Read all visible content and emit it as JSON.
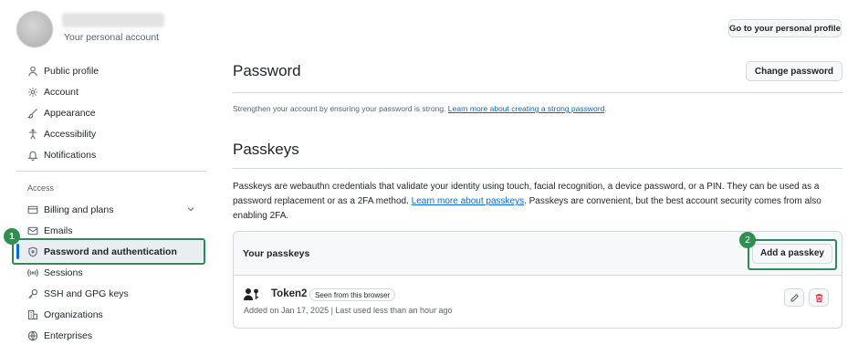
{
  "header": {
    "account_label": "Your personal account",
    "profile_button": "Go to your personal profile"
  },
  "sidebar": {
    "items": [
      {
        "label": "Public profile",
        "icon": "person-icon"
      },
      {
        "label": "Account",
        "icon": "gear-icon"
      },
      {
        "label": "Appearance",
        "icon": "paintbrush-icon"
      },
      {
        "label": "Accessibility",
        "icon": "accessibility-icon"
      },
      {
        "label": "Notifications",
        "icon": "bell-icon"
      }
    ],
    "access_label": "Access",
    "access_items": [
      {
        "label": "Billing and plans",
        "icon": "credit-card-icon"
      },
      {
        "label": "Emails",
        "icon": "mail-icon"
      },
      {
        "label": "Password and authentication",
        "icon": "shield-lock-icon"
      },
      {
        "label": "Sessions",
        "icon": "broadcast-icon"
      },
      {
        "label": "SSH and GPG keys",
        "icon": "key-icon"
      },
      {
        "label": "Organizations",
        "icon": "organization-icon"
      },
      {
        "label": "Enterprises",
        "icon": "globe-icon"
      }
    ]
  },
  "annotations": {
    "step1": "1",
    "step2": "2"
  },
  "password": {
    "title": "Password",
    "change_button": "Change password",
    "description": "Strengthen your account by ensuring your password is strong.",
    "link": "Learn more about creating a strong password",
    "after_link": "."
  },
  "passkeys": {
    "title": "Passkeys",
    "desc_part1": "Passkeys are webauthn credentials that validate your identity using touch, facial recognition, a device password, or a PIN. They can be used as a password replacement or as a 2FA method.",
    "link": "Learn more about passkeys",
    "desc_part2": ". Passkeys are convenient, but the best account security comes from also enabling 2FA.",
    "box_title": "Your passkeys",
    "add_button": "Add a passkey",
    "key": {
      "name": "Token2",
      "badge": "Seen from this browser",
      "meta": "Added on Jan 17, 2025 | Last used less than an hour ago"
    }
  },
  "colors": {
    "accent": "#0969da",
    "highlight": "#2e8b57",
    "danger": "#d1242f"
  }
}
